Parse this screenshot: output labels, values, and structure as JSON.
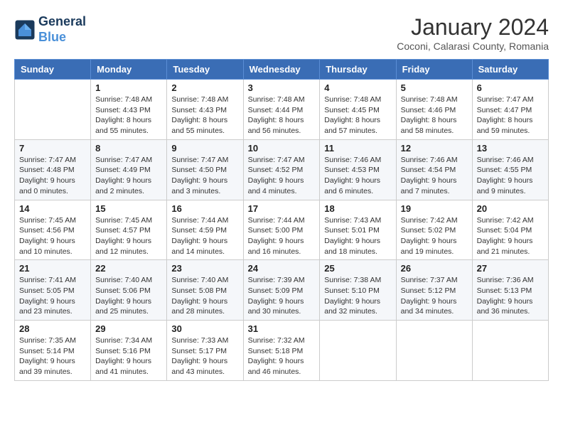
{
  "logo": {
    "line1": "General",
    "line2": "Blue"
  },
  "title": "January 2024",
  "subtitle": "Coconi, Calarasi County, Romania",
  "days_of_week": [
    "Sunday",
    "Monday",
    "Tuesday",
    "Wednesday",
    "Thursday",
    "Friday",
    "Saturday"
  ],
  "weeks": [
    [
      {
        "day": "",
        "sunrise": "",
        "sunset": "",
        "daylight": ""
      },
      {
        "day": "1",
        "sunrise": "Sunrise: 7:48 AM",
        "sunset": "Sunset: 4:43 PM",
        "daylight": "Daylight: 8 hours and 55 minutes."
      },
      {
        "day": "2",
        "sunrise": "Sunrise: 7:48 AM",
        "sunset": "Sunset: 4:43 PM",
        "daylight": "Daylight: 8 hours and 55 minutes."
      },
      {
        "day": "3",
        "sunrise": "Sunrise: 7:48 AM",
        "sunset": "Sunset: 4:44 PM",
        "daylight": "Daylight: 8 hours and 56 minutes."
      },
      {
        "day": "4",
        "sunrise": "Sunrise: 7:48 AM",
        "sunset": "Sunset: 4:45 PM",
        "daylight": "Daylight: 8 hours and 57 minutes."
      },
      {
        "day": "5",
        "sunrise": "Sunrise: 7:48 AM",
        "sunset": "Sunset: 4:46 PM",
        "daylight": "Daylight: 8 hours and 58 minutes."
      },
      {
        "day": "6",
        "sunrise": "Sunrise: 7:47 AM",
        "sunset": "Sunset: 4:47 PM",
        "daylight": "Daylight: 8 hours and 59 minutes."
      }
    ],
    [
      {
        "day": "7",
        "sunrise": "Sunrise: 7:47 AM",
        "sunset": "Sunset: 4:48 PM",
        "daylight": "Daylight: 9 hours and 0 minutes."
      },
      {
        "day": "8",
        "sunrise": "Sunrise: 7:47 AM",
        "sunset": "Sunset: 4:49 PM",
        "daylight": "Daylight: 9 hours and 2 minutes."
      },
      {
        "day": "9",
        "sunrise": "Sunrise: 7:47 AM",
        "sunset": "Sunset: 4:50 PM",
        "daylight": "Daylight: 9 hours and 3 minutes."
      },
      {
        "day": "10",
        "sunrise": "Sunrise: 7:47 AM",
        "sunset": "Sunset: 4:52 PM",
        "daylight": "Daylight: 9 hours and 4 minutes."
      },
      {
        "day": "11",
        "sunrise": "Sunrise: 7:46 AM",
        "sunset": "Sunset: 4:53 PM",
        "daylight": "Daylight: 9 hours and 6 minutes."
      },
      {
        "day": "12",
        "sunrise": "Sunrise: 7:46 AM",
        "sunset": "Sunset: 4:54 PM",
        "daylight": "Daylight: 9 hours and 7 minutes."
      },
      {
        "day": "13",
        "sunrise": "Sunrise: 7:46 AM",
        "sunset": "Sunset: 4:55 PM",
        "daylight": "Daylight: 9 hours and 9 minutes."
      }
    ],
    [
      {
        "day": "14",
        "sunrise": "Sunrise: 7:45 AM",
        "sunset": "Sunset: 4:56 PM",
        "daylight": "Daylight: 9 hours and 10 minutes."
      },
      {
        "day": "15",
        "sunrise": "Sunrise: 7:45 AM",
        "sunset": "Sunset: 4:57 PM",
        "daylight": "Daylight: 9 hours and 12 minutes."
      },
      {
        "day": "16",
        "sunrise": "Sunrise: 7:44 AM",
        "sunset": "Sunset: 4:59 PM",
        "daylight": "Daylight: 9 hours and 14 minutes."
      },
      {
        "day": "17",
        "sunrise": "Sunrise: 7:44 AM",
        "sunset": "Sunset: 5:00 PM",
        "daylight": "Daylight: 9 hours and 16 minutes."
      },
      {
        "day": "18",
        "sunrise": "Sunrise: 7:43 AM",
        "sunset": "Sunset: 5:01 PM",
        "daylight": "Daylight: 9 hours and 18 minutes."
      },
      {
        "day": "19",
        "sunrise": "Sunrise: 7:42 AM",
        "sunset": "Sunset: 5:02 PM",
        "daylight": "Daylight: 9 hours and 19 minutes."
      },
      {
        "day": "20",
        "sunrise": "Sunrise: 7:42 AM",
        "sunset": "Sunset: 5:04 PM",
        "daylight": "Daylight: 9 hours and 21 minutes."
      }
    ],
    [
      {
        "day": "21",
        "sunrise": "Sunrise: 7:41 AM",
        "sunset": "Sunset: 5:05 PM",
        "daylight": "Daylight: 9 hours and 23 minutes."
      },
      {
        "day": "22",
        "sunrise": "Sunrise: 7:40 AM",
        "sunset": "Sunset: 5:06 PM",
        "daylight": "Daylight: 9 hours and 25 minutes."
      },
      {
        "day": "23",
        "sunrise": "Sunrise: 7:40 AM",
        "sunset": "Sunset: 5:08 PM",
        "daylight": "Daylight: 9 hours and 28 minutes."
      },
      {
        "day": "24",
        "sunrise": "Sunrise: 7:39 AM",
        "sunset": "Sunset: 5:09 PM",
        "daylight": "Daylight: 9 hours and 30 minutes."
      },
      {
        "day": "25",
        "sunrise": "Sunrise: 7:38 AM",
        "sunset": "Sunset: 5:10 PM",
        "daylight": "Daylight: 9 hours and 32 minutes."
      },
      {
        "day": "26",
        "sunrise": "Sunrise: 7:37 AM",
        "sunset": "Sunset: 5:12 PM",
        "daylight": "Daylight: 9 hours and 34 minutes."
      },
      {
        "day": "27",
        "sunrise": "Sunrise: 7:36 AM",
        "sunset": "Sunset: 5:13 PM",
        "daylight": "Daylight: 9 hours and 36 minutes."
      }
    ],
    [
      {
        "day": "28",
        "sunrise": "Sunrise: 7:35 AM",
        "sunset": "Sunset: 5:14 PM",
        "daylight": "Daylight: 9 hours and 39 minutes."
      },
      {
        "day": "29",
        "sunrise": "Sunrise: 7:34 AM",
        "sunset": "Sunset: 5:16 PM",
        "daylight": "Daylight: 9 hours and 41 minutes."
      },
      {
        "day": "30",
        "sunrise": "Sunrise: 7:33 AM",
        "sunset": "Sunset: 5:17 PM",
        "daylight": "Daylight: 9 hours and 43 minutes."
      },
      {
        "day": "31",
        "sunrise": "Sunrise: 7:32 AM",
        "sunset": "Sunset: 5:18 PM",
        "daylight": "Daylight: 9 hours and 46 minutes."
      },
      {
        "day": "",
        "sunrise": "",
        "sunset": "",
        "daylight": ""
      },
      {
        "day": "",
        "sunrise": "",
        "sunset": "",
        "daylight": ""
      },
      {
        "day": "",
        "sunrise": "",
        "sunset": "",
        "daylight": ""
      }
    ]
  ]
}
